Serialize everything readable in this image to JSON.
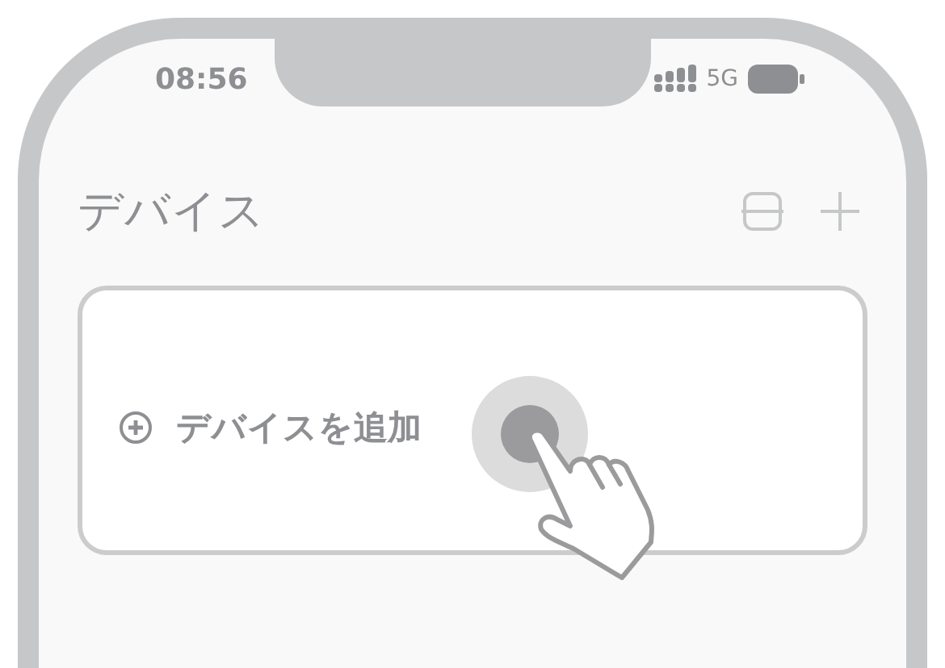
{
  "status_bar": {
    "time": "08:56",
    "network": "5G"
  },
  "header": {
    "title": "デバイス"
  },
  "add_card": {
    "label": "デバイスを追加"
  }
}
